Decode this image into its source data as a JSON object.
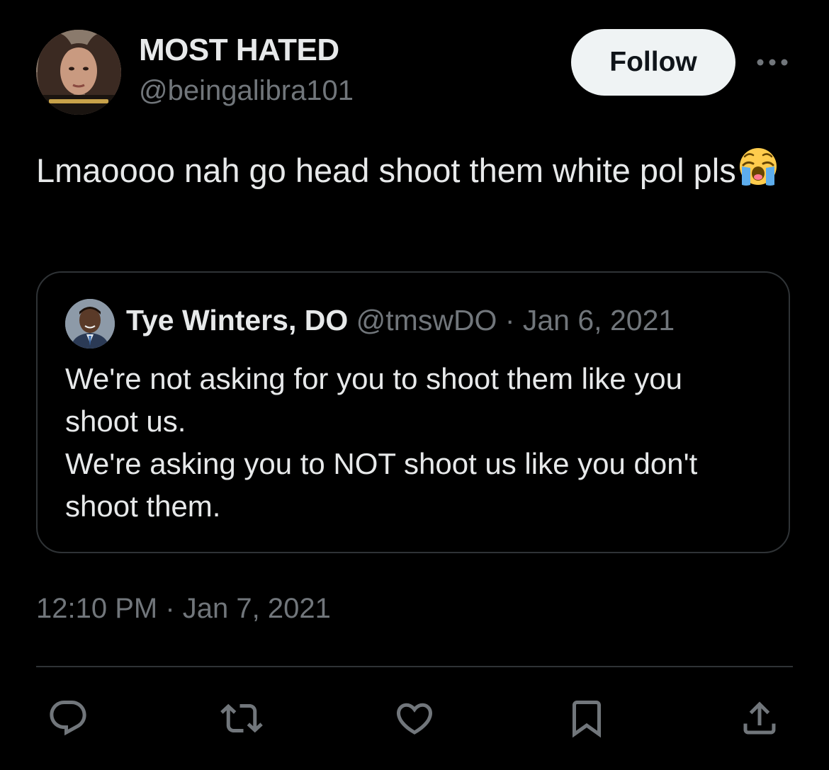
{
  "author": {
    "display_name": "MOST HATED",
    "handle": "@beingalibra101"
  },
  "follow_label": "Follow",
  "tweet": {
    "text": "Lmaoooo nah go head shoot them white pol pls",
    "emoji": "loudly-crying-face"
  },
  "quoted_tweet": {
    "name": "Tye Winters, DO",
    "meta": "@tmswDO · Jan 6, 2021",
    "lines": [
      "We're not asking for you to shoot them like you",
      "shoot us.",
      "We're asking you to NOT shoot us like you don't",
      "shoot them."
    ]
  },
  "timestamp": "12:10 PM · Jan 7, 2021",
  "actions": [
    "reply-icon",
    "retweet-icon",
    "like-icon",
    "bookmark-icon",
    "share-icon"
  ],
  "colors": {
    "background": "#000000",
    "primary_text": "#e7e9ea",
    "secondary_text": "#71767b",
    "border": "#2f3336",
    "follow_bg": "#eff3f4"
  }
}
